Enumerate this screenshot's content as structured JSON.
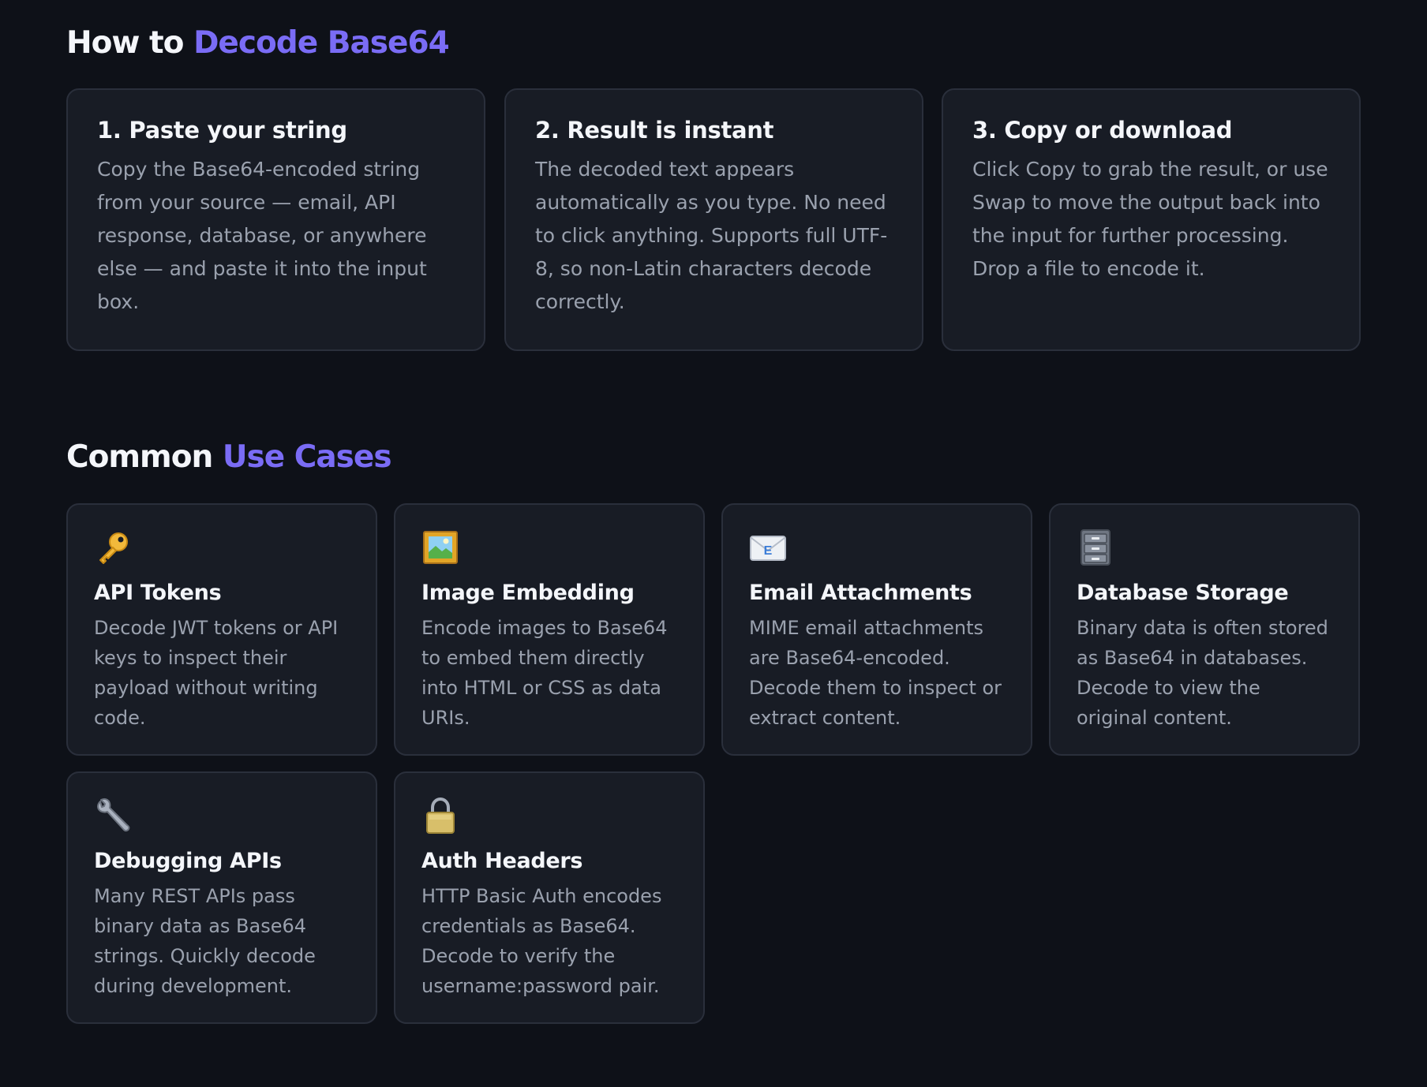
{
  "how_to": {
    "title_prefix": "How to ",
    "title_accent": "Decode Base64",
    "steps": [
      {
        "title": "1. Paste your string",
        "body": "Copy the Base64-encoded string from your source — email, API response, database, or anywhere else — and paste it into the input box."
      },
      {
        "title": "2. Result is instant",
        "body": "The decoded text appears automatically as you type. No need to click anything. Supports full UTF-8, so non-Latin characters decode correctly."
      },
      {
        "title": "3. Copy or download",
        "body": "Click Copy to grab the result, or use Swap to move the output back into the input for further processing. Drop a file to encode it."
      }
    ]
  },
  "use_cases": {
    "title_prefix": "Common ",
    "title_accent": "Use Cases",
    "items": [
      {
        "icon": "key-icon",
        "title": "API Tokens",
        "body": "Decode JWT tokens or API keys to inspect their payload without writing code."
      },
      {
        "icon": "framed-picture-icon",
        "title": "Image Embedding",
        "body": "Encode images to Base64 to embed them directly into HTML or CSS as data URIs."
      },
      {
        "icon": "email-icon",
        "title": "Email Attachments",
        "body": "MIME email attachments are Base64-encoded. Decode them to inspect or extract content."
      },
      {
        "icon": "file-cabinet-icon",
        "title": "Database Storage",
        "body": "Binary data is often stored as Base64 in databases. Decode to view the original content."
      },
      {
        "icon": "wrench-icon",
        "title": "Debugging APIs",
        "body": "Many REST APIs pass binary data as Base64 strings. Quickly decode during development."
      },
      {
        "icon": "padlock-icon",
        "title": "Auth Headers",
        "body": "HTTP Basic Auth encodes credentials as Base64. Decode to verify the username:password pair."
      }
    ]
  },
  "colors": {
    "background": "#0e1118",
    "card": "#181c25",
    "card_border": "#2a2f3b",
    "accent": "#7a6cf5",
    "heading": "#f4f6fa",
    "body_text": "#9aa1ae"
  }
}
